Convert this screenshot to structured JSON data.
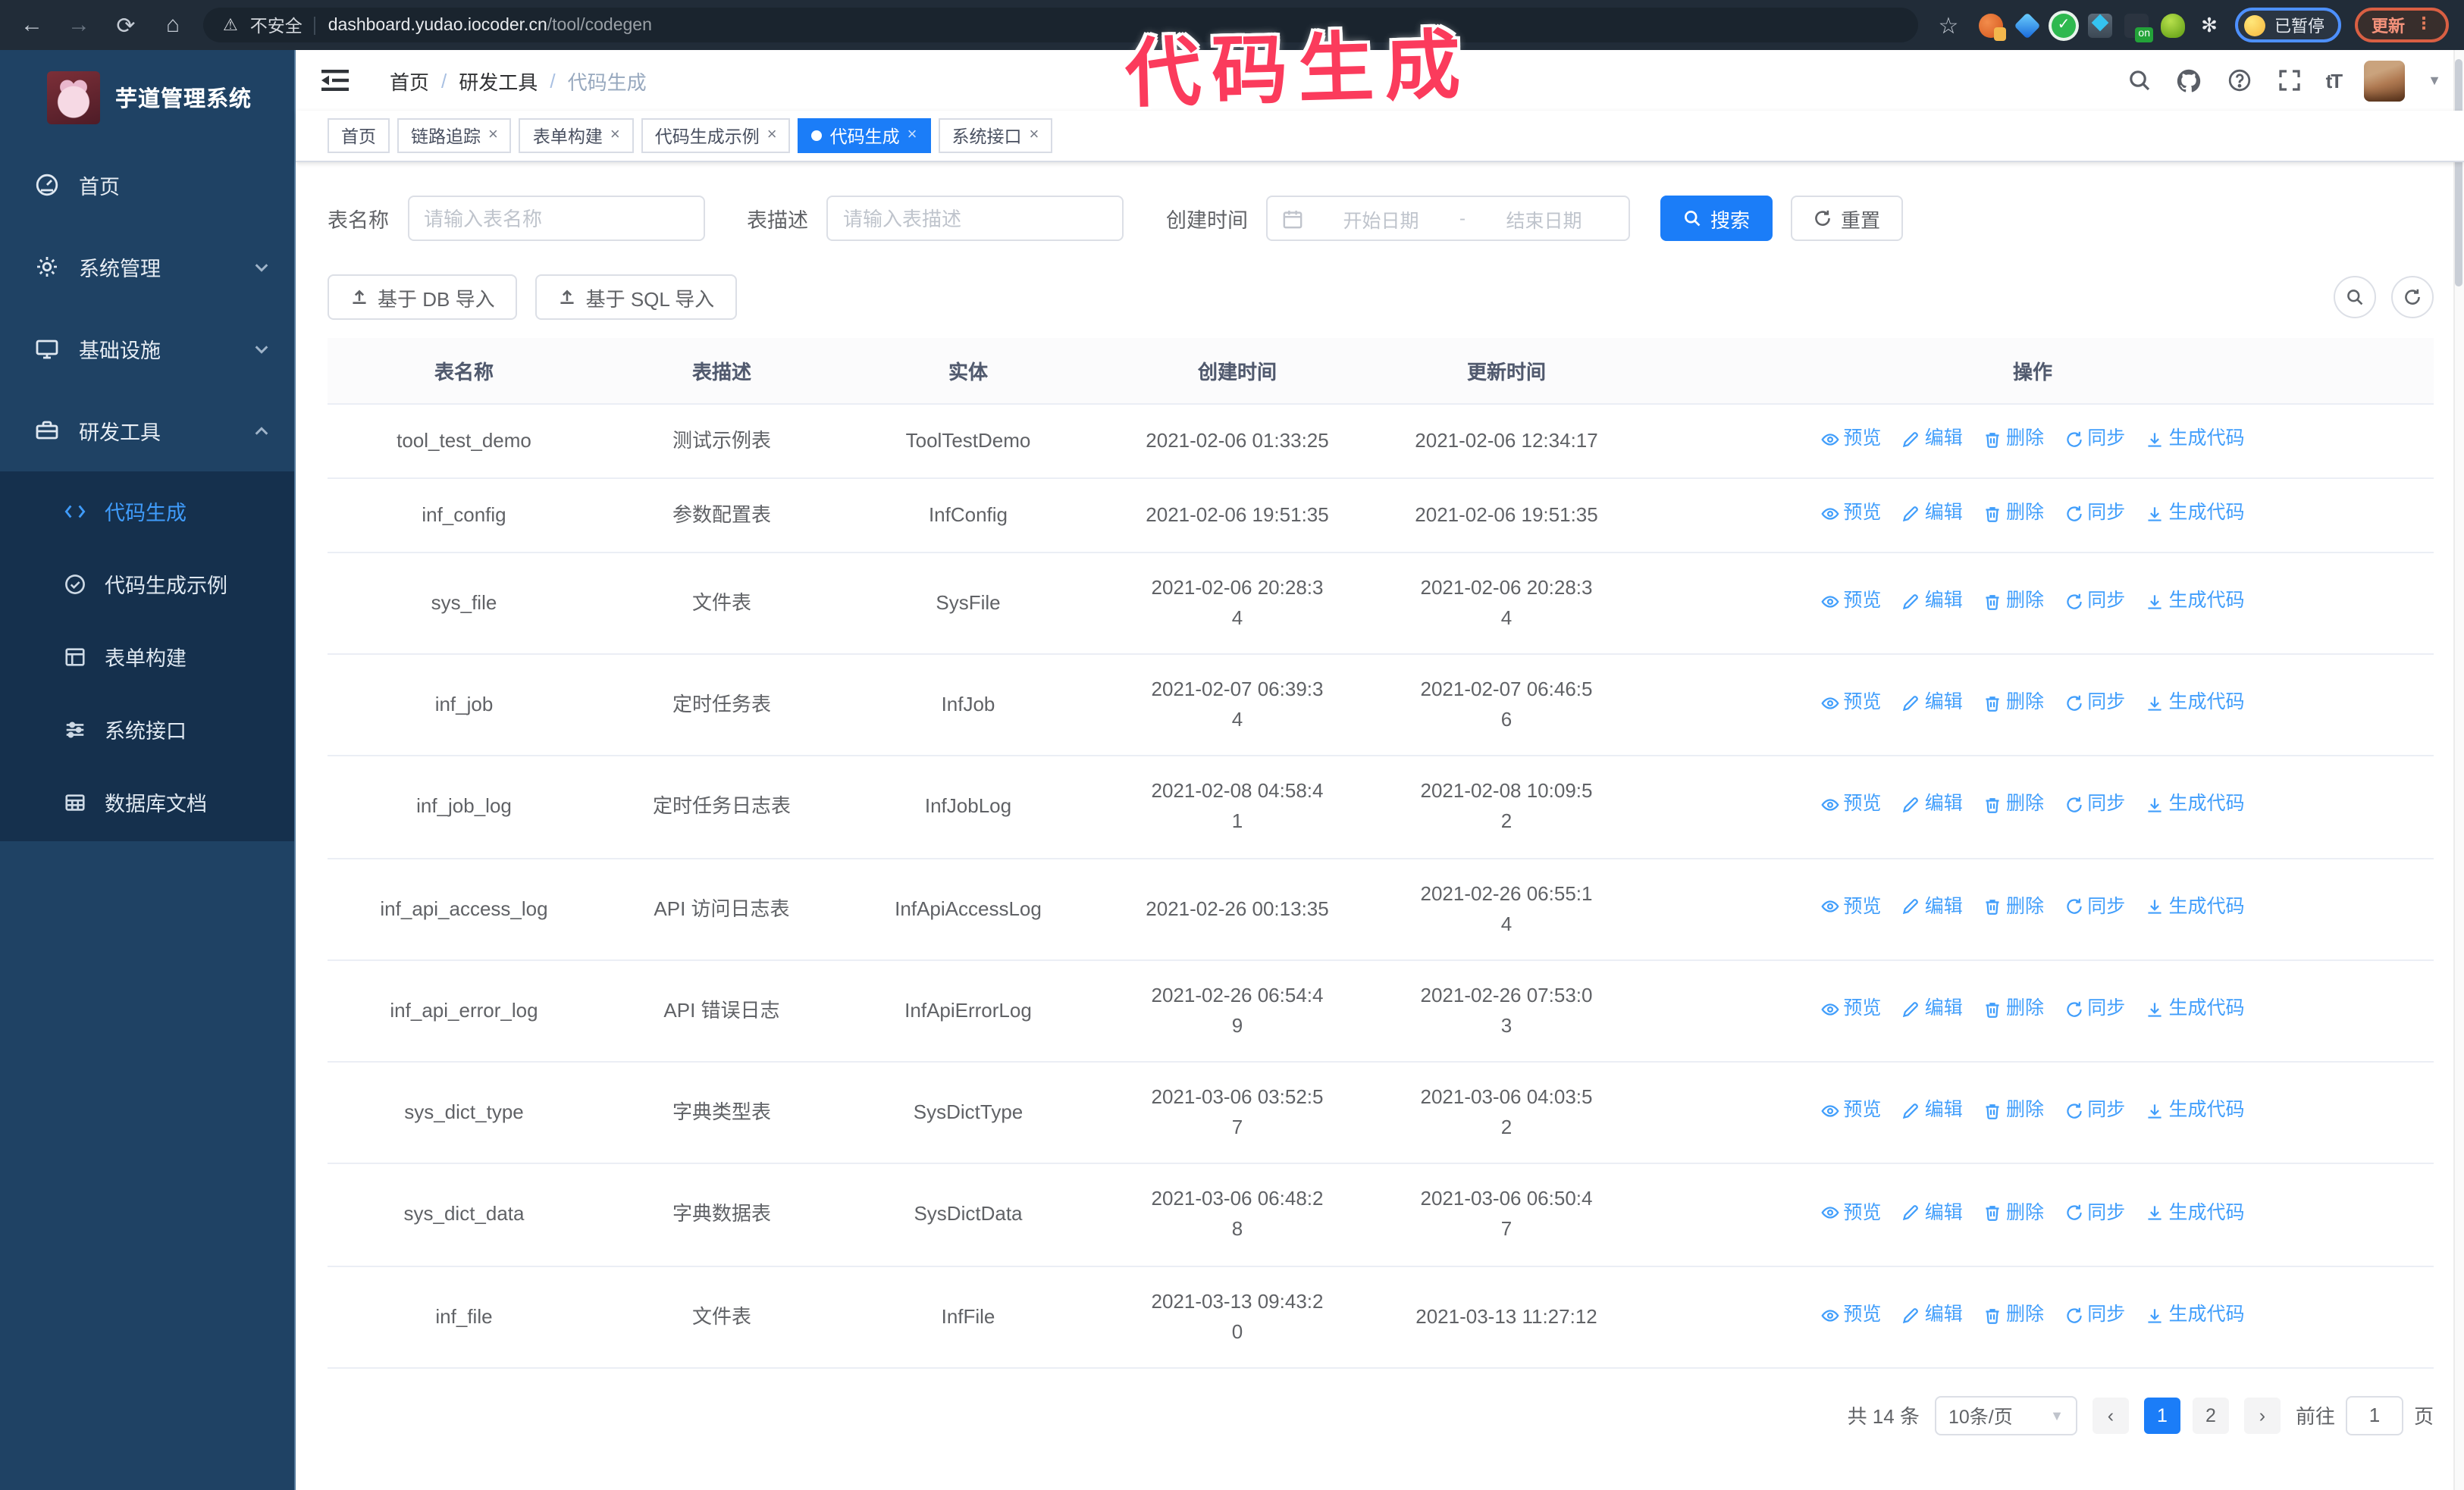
{
  "colors": {
    "primary": "#1b7df8",
    "link": "#419efb",
    "sidebar_bg": "#1f4264",
    "submenu_bg": "#15304d",
    "annotation": "#fb3b5c",
    "tab_active": "#1b7df8"
  },
  "browser": {
    "security_label": "不安全",
    "url_host": "dashboard.yudao.iocoder.cn",
    "url_path": "/tool/codegen",
    "profile_badge": "已暂停",
    "update_button": "更新"
  },
  "annotation": {
    "text": "代码生成"
  },
  "sidebar": {
    "title": "芋道管理系统",
    "items": [
      {
        "label": "首页"
      },
      {
        "label": "系统管理"
      },
      {
        "label": "基础设施"
      },
      {
        "label": "研发工具"
      }
    ],
    "submenu": [
      {
        "label": "代码生成",
        "active": true
      },
      {
        "label": "代码生成示例"
      },
      {
        "label": "表单构建"
      },
      {
        "label": "系统接口"
      },
      {
        "label": "数据库文档"
      }
    ]
  },
  "breadcrumb": [
    "首页",
    "研发工具",
    "代码生成"
  ],
  "tabs": [
    {
      "label": "首页",
      "closable": false,
      "active": false
    },
    {
      "label": "链路追踪",
      "closable": true,
      "active": false
    },
    {
      "label": "表单构建",
      "closable": true,
      "active": false
    },
    {
      "label": "代码生成示例",
      "closable": true,
      "active": false
    },
    {
      "label": "代码生成",
      "closable": true,
      "active": true
    },
    {
      "label": "系统接口",
      "closable": true,
      "active": false
    }
  ],
  "filters": {
    "table_name_label": "表名称",
    "table_name_placeholder": "请输入表名称",
    "table_desc_label": "表描述",
    "table_desc_placeholder": "请输入表描述",
    "create_time_label": "创建时间",
    "date_start_placeholder": "开始日期",
    "date_separator": "-",
    "date_end_placeholder": "结束日期",
    "search_button": "搜索",
    "reset_button": "重置"
  },
  "toolbar": {
    "import_db": "基于 DB 导入",
    "import_sql": "基于 SQL 导入"
  },
  "table": {
    "columns": [
      "表名称",
      "表描述",
      "实体",
      "创建时间",
      "更新时间",
      "操作"
    ],
    "actions": [
      "预览",
      "编辑",
      "删除",
      "同步",
      "生成代码"
    ],
    "rows": [
      {
        "name": "tool_test_demo",
        "desc": "测试示例表",
        "entity": "ToolTestDemo",
        "created": "2021-02-06 01:33:25",
        "updated": "2021-02-06 12:34:17"
      },
      {
        "name": "inf_config",
        "desc": "参数配置表",
        "entity": "InfConfig",
        "created": "2021-02-06 19:51:35",
        "updated": "2021-02-06 19:51:35"
      },
      {
        "name": "sys_file",
        "desc": "文件表",
        "entity": "SysFile",
        "created": "2021-02-06 20:28:3\n4",
        "updated": "2021-02-06 20:28:3\n4"
      },
      {
        "name": "inf_job",
        "desc": "定时任务表",
        "entity": "InfJob",
        "created": "2021-02-07 06:39:3\n4",
        "updated": "2021-02-07 06:46:5\n6"
      },
      {
        "name": "inf_job_log",
        "desc": "定时任务日志表",
        "entity": "InfJobLog",
        "created": "2021-02-08 04:58:4\n1",
        "updated": "2021-02-08 10:09:5\n2"
      },
      {
        "name": "inf_api_access_log",
        "desc": "API 访问日志表",
        "entity": "InfApiAccessLog",
        "created": "2021-02-26 00:13:35",
        "updated": "2021-02-26 06:55:1\n4"
      },
      {
        "name": "inf_api_error_log",
        "desc": "API 错误日志",
        "entity": "InfApiErrorLog",
        "created": "2021-02-26 06:54:4\n9",
        "updated": "2021-02-26 07:53:0\n3"
      },
      {
        "name": "sys_dict_type",
        "desc": "字典类型表",
        "entity": "SysDictType",
        "created": "2021-03-06 03:52:5\n7",
        "updated": "2021-03-06 04:03:5\n2"
      },
      {
        "name": "sys_dict_data",
        "desc": "字典数据表",
        "entity": "SysDictData",
        "created": "2021-03-06 06:48:2\n8",
        "updated": "2021-03-06 06:50:4\n7"
      },
      {
        "name": "inf_file",
        "desc": "文件表",
        "entity": "InfFile",
        "created": "2021-03-13 09:43:2\n0",
        "updated": "2021-03-13 11:27:12"
      }
    ]
  },
  "pagination": {
    "total": "共 14 条",
    "page_size": "10条/页",
    "pages": [
      "1",
      "2"
    ],
    "active_page": "1",
    "goto_label": "前往",
    "goto_value": "1",
    "goto_suffix": "页"
  }
}
